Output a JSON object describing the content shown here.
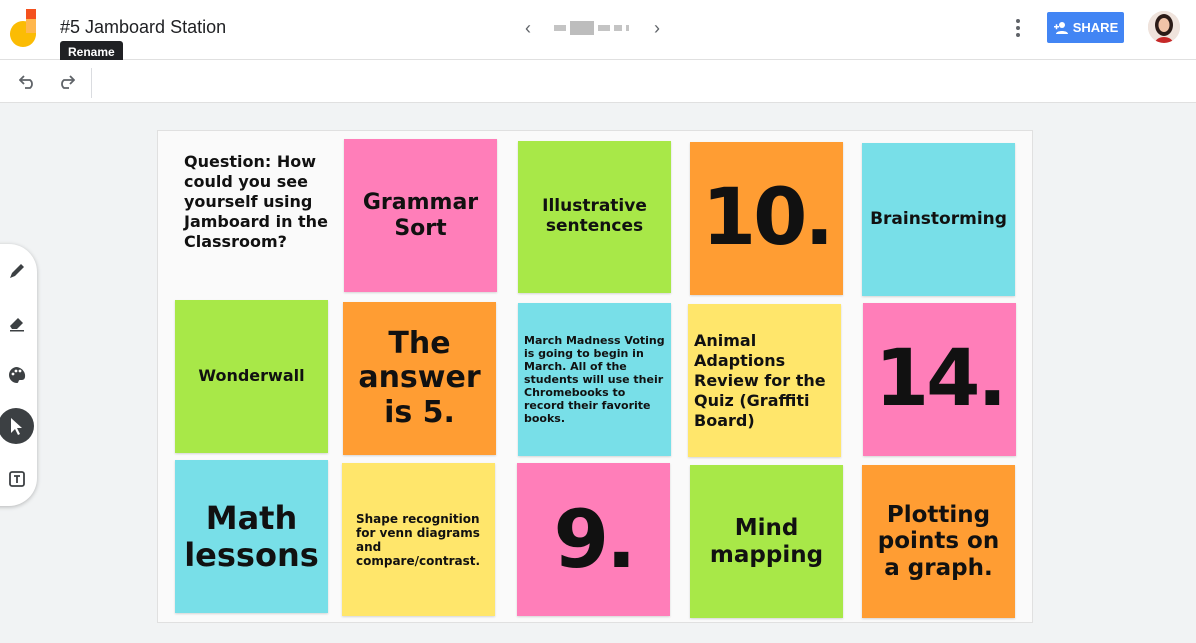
{
  "header": {
    "title": "#5 Jamboard Station",
    "tooltip": "Rename",
    "share_label": "SHARE"
  },
  "toolbar": {
    "undo_icon": "undo-icon",
    "redo_icon": "redo-icon"
  },
  "tools": [
    "pen-icon",
    "eraser-icon",
    "palette-icon",
    "select-icon",
    "text-box-icon"
  ],
  "board": {
    "question": "Question: How could you see yourself using Jamboard in the Classroom?",
    "notes": [
      {
        "text": "Grammar Sort",
        "color": "#ff7eb9"
      },
      {
        "text": "Illustrative sentences",
        "color": "#a8e848"
      },
      {
        "text": "10.",
        "color": "#ff9d33"
      },
      {
        "text": "Brainstorming",
        "color": "#78dfe8"
      },
      {
        "text": "Wonderwall",
        "color": "#a8e848"
      },
      {
        "text": "The answer is 5.",
        "color": "#ff9d33"
      },
      {
        "text": "March Madness Voting is going to begin in March. All of the students will use their Chromebooks to record their favorite books.",
        "color": "#78dfe8"
      },
      {
        "text": "Animal Adaptions Review for the Quiz (Graffiti Board)",
        "color": "#ffe66b"
      },
      {
        "text": "14.",
        "color": "#ff7eb9"
      },
      {
        "text": "Math lessons",
        "color": "#78dfe8"
      },
      {
        "text": "Shape recognition for venn diagrams and compare/contrast.",
        "color": "#ffe66b"
      },
      {
        "text": "9.",
        "color": "#ff7eb9"
      },
      {
        "text": "Mind mapping",
        "color": "#a8e848"
      },
      {
        "text": "Plotting points on a graph.",
        "color": "#ff9d33"
      }
    ]
  }
}
